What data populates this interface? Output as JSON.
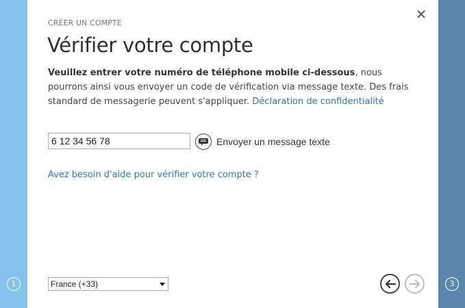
{
  "steps": {
    "left": "1",
    "right": "3"
  },
  "header": {
    "subheading": "CRÉER UN COMPTE",
    "title": "Vérifier votre compte",
    "close_icon": "close-icon"
  },
  "description": {
    "bold": "Veuillez entrer votre numéro de téléphone mobile ci-dessous",
    "rest": ", nous pourrons ainsi vous envoyer un code de vérification via message texte. Des frais standard de messagerie peuvent s'appliquer. ",
    "privacy_link": "Déclaration de confidentialité"
  },
  "phone": {
    "value": "6 12 34 56 78",
    "send_icon": "message-icon",
    "send_label": "Envoyer un message texte"
  },
  "help_link": "Avez besoin d'aide pour vérifier votre compte ?",
  "country_select": {
    "selected": "France (+33)"
  },
  "nav": {
    "back_icon": "arrow-left-icon",
    "next_icon": "arrow-right-icon"
  },
  "colors": {
    "left_rail": "#86c1ec",
    "right_rail": "#5a86ad",
    "link": "#2a78b5"
  }
}
